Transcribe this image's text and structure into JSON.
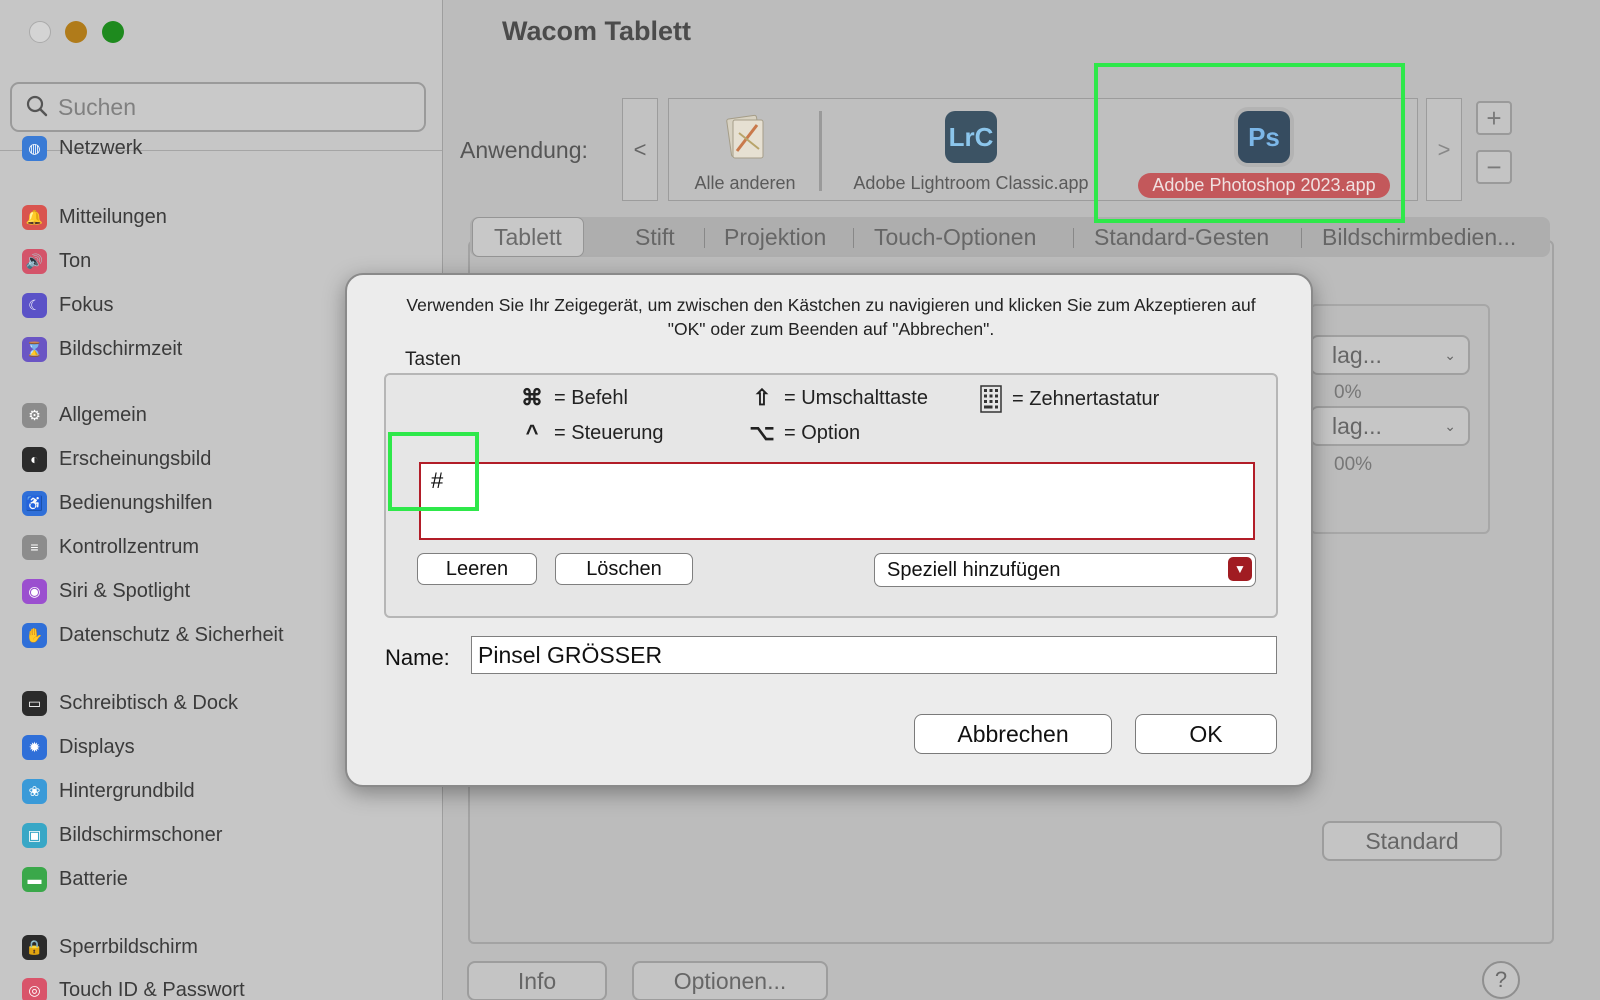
{
  "sidebar": {
    "search_placeholder": "Suchen",
    "partial_item": "Netzwerk",
    "items": [
      {
        "label": "Mitteilungen",
        "icon": "bell-icon",
        "color": "#d9544f"
      },
      {
        "label": "Ton",
        "icon": "speaker-icon",
        "color": "#d4546a"
      },
      {
        "label": "Fokus",
        "icon": "moon-icon",
        "color": "#5b52c7"
      },
      {
        "label": "Bildschirmzeit",
        "icon": "hourglass-icon",
        "color": "#6a55c4"
      },
      {
        "label": "Allgemein",
        "icon": "gear-icon",
        "color": "#8c8c8c"
      },
      {
        "label": "Erscheinungsbild",
        "icon": "appearance-icon",
        "color": "#2b2b2b"
      },
      {
        "label": "Bedienungshilfen",
        "icon": "accessibility-icon",
        "color": "#2f6fd8"
      },
      {
        "label": "Kontrollzentrum",
        "icon": "control-center-icon",
        "color": "#8c8c8c"
      },
      {
        "label": "Siri & Spotlight",
        "icon": "siri-icon",
        "color": "#9b4fcf"
      },
      {
        "label": "Datenschutz & Sicherheit",
        "icon": "hand-icon",
        "color": "#2f6fd8"
      },
      {
        "label": "Schreibtisch & Dock",
        "icon": "dock-icon",
        "color": "#2b2b2b"
      },
      {
        "label": "Displays",
        "icon": "sun-icon",
        "color": "#2f6fd8"
      },
      {
        "label": "Hintergrundbild",
        "icon": "flower-icon",
        "color": "#3a9ad8"
      },
      {
        "label": "Bildschirmschoner",
        "icon": "screensaver-icon",
        "color": "#38a7c6"
      },
      {
        "label": "Batterie",
        "icon": "battery-icon",
        "color": "#3aa84a"
      },
      {
        "label": "Sperrbildschirm",
        "icon": "lock-icon",
        "color": "#2b2b2b"
      },
      {
        "label": "Touch ID & Passwort",
        "icon": "fingerprint-icon",
        "color": "#d9546a"
      }
    ]
  },
  "main": {
    "title": "Wacom Tablett",
    "app_label": "Anwendung:",
    "nav_prev": "<",
    "nav_next": ">",
    "apps": [
      {
        "name": "Alle anderen",
        "icon": "all-apps-icon"
      },
      {
        "name": "Adobe Lightroom Classic.app",
        "icon_text": "LrC",
        "icon": "lightroom-icon"
      },
      {
        "name": "Adobe Photoshop 2023.app",
        "icon_text": "Ps",
        "icon": "photoshop-icon",
        "selected": true
      }
    ],
    "add": "+",
    "remove": "−",
    "tabs": [
      "Tablett",
      "Stift",
      "Projektion",
      "Touch-Optionen",
      "Standard-Gesten",
      "Bildschirmbedien..."
    ],
    "active_tab": "Tablett",
    "bg_select_1": "lag...",
    "bg_pct_1": "0%",
    "bg_select_2": "lag...",
    "bg_pct_2": "00%",
    "standard_button": "Standard",
    "info_button": "Info",
    "options_button": "Optionen...",
    "help": "?"
  },
  "dialog": {
    "instruction": "Verwenden Sie Ihr Zeigegerät, um zwischen den Kästchen zu navigieren und klicken Sie zum Akzeptieren auf \"OK\" oder zum Beenden auf \"Abbrechen\".",
    "keys_label": "Tasten",
    "legend": {
      "cmd_symbol": "⌘",
      "cmd_label": "= Befehl",
      "ctrl_symbol": "^",
      "ctrl_label": "= Steuerung",
      "shift_symbol": "⇧",
      "shift_label": "= Umschalttaste",
      "opt_symbol": "⌥",
      "opt_label": "= Option",
      "numpad_label": "= Zehnertastatur"
    },
    "keys_value": "#",
    "clear_button": "Leeren",
    "delete_button": "Löschen",
    "special_add": "Speziell hinzufügen",
    "name_label": "Name:",
    "name_value": "Pinsel GRÖSSER",
    "cancel_button": "Abbrechen",
    "ok_button": "OK"
  },
  "colors": {
    "highlight": "#2ee84a",
    "accent_red": "#b21d28",
    "selected_app": "#c3585b"
  }
}
